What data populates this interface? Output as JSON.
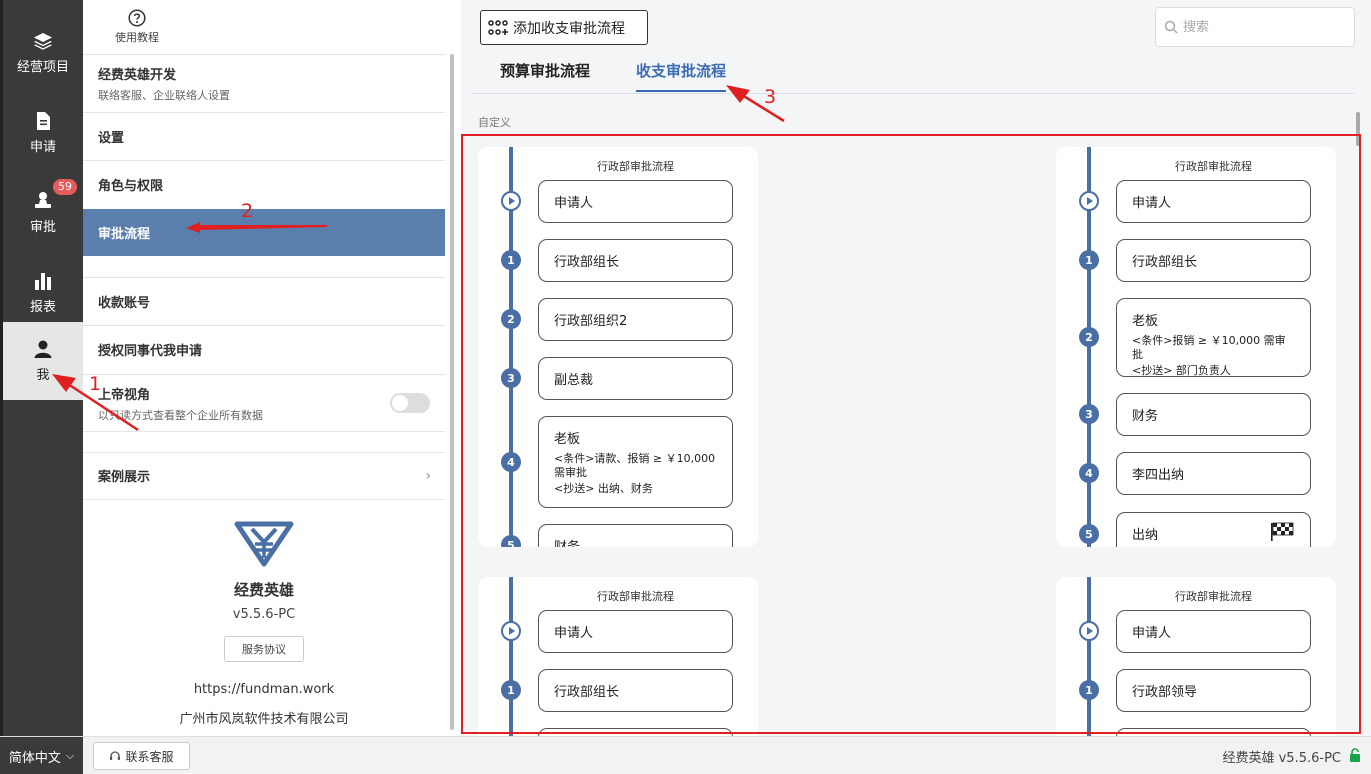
{
  "rail": {
    "items": [
      {
        "label": "经营项目",
        "icon": "layers-icon"
      },
      {
        "label": "申请",
        "icon": "document-icon"
      },
      {
        "label": "审批",
        "icon": "stamp-icon",
        "badge": "59"
      },
      {
        "label": "报表",
        "icon": "bar-chart-icon"
      },
      {
        "label": "我",
        "icon": "user-icon"
      }
    ],
    "active_index": 4
  },
  "panel": {
    "help_label": "使用教程",
    "company": {
      "name": "经费英雄开发",
      "sub": "联络客服、企业联络人设置"
    },
    "items": [
      "设置",
      "角色与权限",
      "审批流程",
      "收款账号",
      "授权同事代我申请"
    ],
    "god_view": {
      "label": "上帝视角",
      "sub": "以只读方式查看整个企业所有数据",
      "enabled": false
    },
    "cases_label": "案例展示",
    "app_name": "经费英雄",
    "version": "v5.5.6-PC",
    "agreement_label": "服务协议",
    "website": "https://fundman.work",
    "company_name": "广州市风岚软件技术有限公司"
  },
  "main": {
    "add_button": "添加收支审批流程",
    "search_placeholder": "搜索",
    "tabs": [
      "预算审批流程",
      "收支审批流程"
    ],
    "active_tab": 1,
    "section_label": "自定义",
    "cards": [
      {
        "title": "行政部审批流程",
        "steps": [
          {
            "num": "",
            "name": "申请人"
          },
          {
            "num": "1",
            "name": "行政部组长"
          },
          {
            "num": "2",
            "name": "行政部组织2"
          },
          {
            "num": "3",
            "name": "副总裁"
          },
          {
            "num": "4",
            "name": "老板",
            "cond1": "<条件>请款、报销 ≥ ￥10,000 需审批",
            "cond2": "<抄送> 出纳、财务"
          },
          {
            "num": "5",
            "name": "财务"
          }
        ]
      },
      {
        "title": "行政部审批流程",
        "steps": [
          {
            "num": "",
            "name": "申请人"
          },
          {
            "num": "1",
            "name": "行政部组长"
          },
          {
            "num": "2",
            "name": "老板",
            "cond1": "<条件>报销 ≥ ￥10,000 需审批",
            "cond2": "<抄送> 部门负责人"
          },
          {
            "num": "3",
            "name": "财务"
          },
          {
            "num": "4",
            "name": "李四出纳"
          },
          {
            "num": "5",
            "name": "出纳"
          }
        ]
      },
      {
        "title": "行政部审批流程",
        "steps": [
          {
            "num": "",
            "name": "申请人"
          },
          {
            "num": "1",
            "name": "行政部组长"
          }
        ]
      },
      {
        "title": "行政部审批流程",
        "steps": [
          {
            "num": "",
            "name": "申请人"
          },
          {
            "num": "1",
            "name": "行政部领导"
          }
        ]
      }
    ]
  },
  "annotations": [
    "1",
    "2",
    "3"
  ],
  "footer": {
    "language": "简体中文",
    "support_label": "联系客服",
    "version_text": "经费英雄 v5.5.6-PC"
  },
  "colors": {
    "accent": "#4a6fa5",
    "active_menu": "#5b7fad",
    "annotation": "#e02020",
    "rail": "#3a3a3a"
  }
}
